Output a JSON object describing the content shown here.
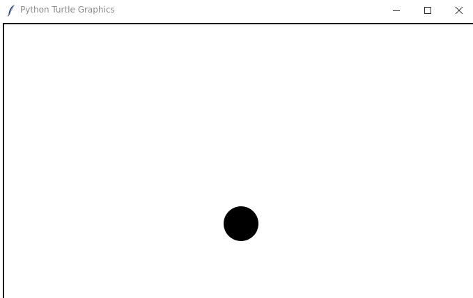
{
  "window": {
    "title": "Python Turtle Graphics",
    "icon": "feather-icon",
    "controls": [
      {
        "name": "minimize-button",
        "icon": "minimize-icon"
      },
      {
        "name": "maximize-button",
        "icon": "maximize-icon"
      },
      {
        "name": "close-button",
        "icon": "close-icon"
      }
    ]
  },
  "canvas": {
    "background": "#ffffff",
    "dot_color": "#000000"
  }
}
